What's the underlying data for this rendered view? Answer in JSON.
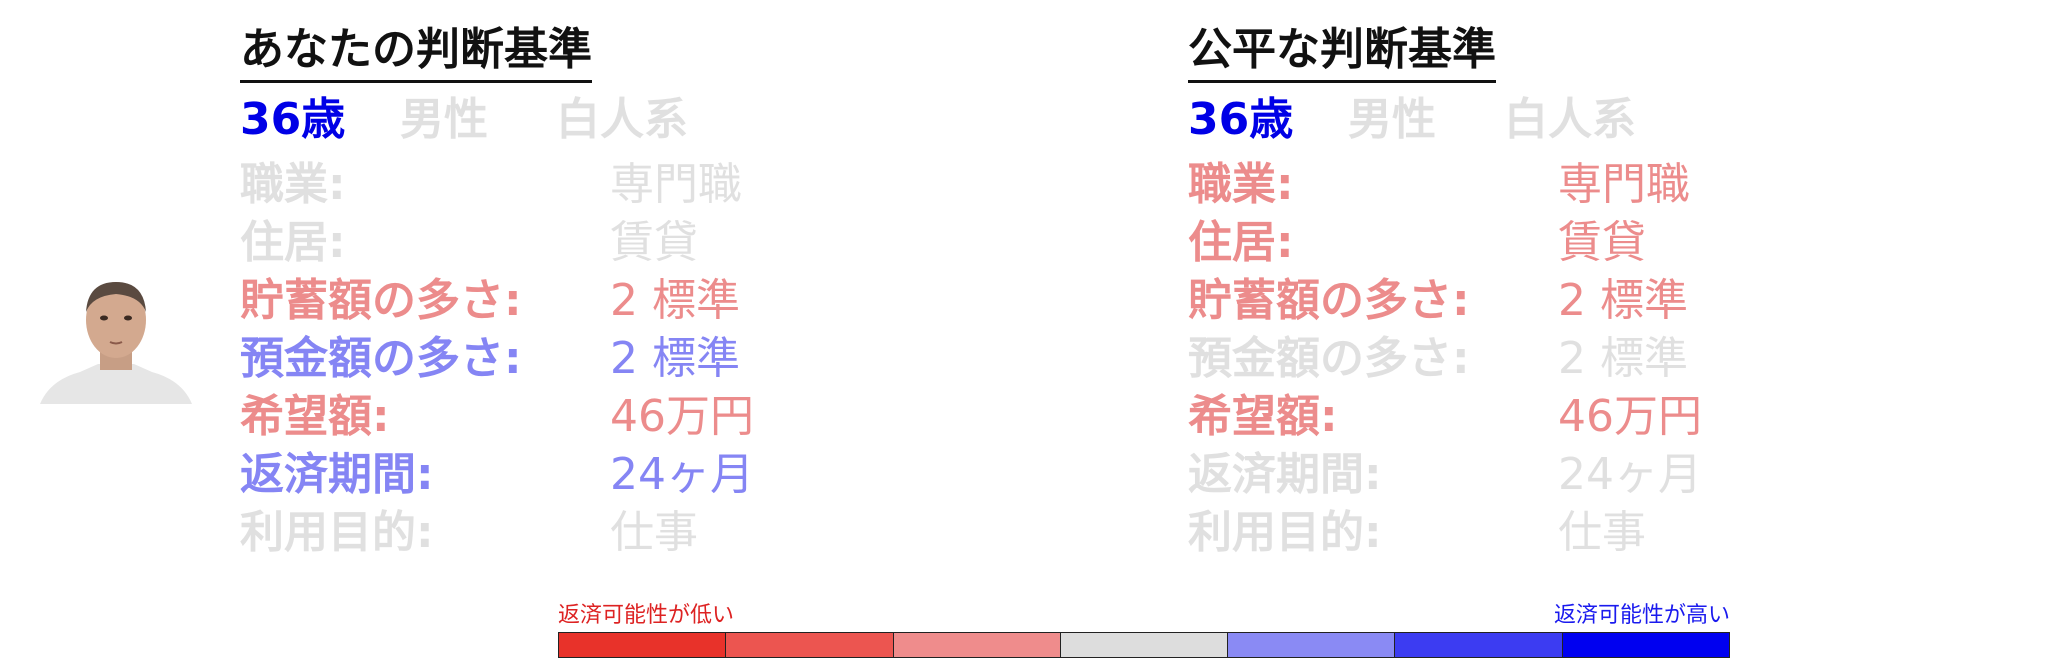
{
  "left_panel": {
    "title": "あなたの判断基準",
    "demographics": {
      "age": "36歳",
      "gender": "男性",
      "race": "白人系"
    },
    "rows": [
      {
        "label": "職業:",
        "value": "専門職",
        "emphasis": "none"
      },
      {
        "label": "住居:",
        "value": "賃貸",
        "emphasis": "none"
      },
      {
        "label": "貯蓄額の多さ:",
        "value": "2 標準",
        "emphasis": "red"
      },
      {
        "label": "預金額の多さ:",
        "value": "2 標準",
        "emphasis": "blue"
      },
      {
        "label": "希望額:",
        "value": "46万円",
        "emphasis": "red"
      },
      {
        "label": "返済期間:",
        "value": "24ヶ月",
        "emphasis": "blue"
      },
      {
        "label": "利用目的:",
        "value": "仕事",
        "emphasis": "none"
      }
    ]
  },
  "right_panel": {
    "title": "公平な判断基準",
    "demographics": {
      "age": "36歳",
      "gender": "男性",
      "race": "白人系"
    },
    "rows": [
      {
        "label": "職業:",
        "value": "専門職",
        "emphasis": "red"
      },
      {
        "label": "住居:",
        "value": "賃貸",
        "emphasis": "red"
      },
      {
        "label": "貯蓄額の多さ:",
        "value": "2 標準",
        "emphasis": "red"
      },
      {
        "label": "預金額の多さ:",
        "value": "2 標準",
        "emphasis": "none"
      },
      {
        "label": "希望額:",
        "value": "46万円",
        "emphasis": "red"
      },
      {
        "label": "返済期間:",
        "value": "24ヶ月",
        "emphasis": "none"
      },
      {
        "label": "利用目的:",
        "value": "仕事",
        "emphasis": "none"
      }
    ]
  },
  "legend": {
    "low_label": "返済可能性が低い",
    "high_label": "返済可能性が高い",
    "scale_colors": [
      "#e8322a",
      "#ec5550",
      "#ef8c8c",
      "#dddddd",
      "#8a8af4",
      "#3c3cf2",
      "#0000f0"
    ]
  },
  "colors": {
    "emphasis_red": "#ec8c8c",
    "emphasis_blue": "#8585f4",
    "muted": "#e0e0e0",
    "age_blue": "#0000e6"
  }
}
